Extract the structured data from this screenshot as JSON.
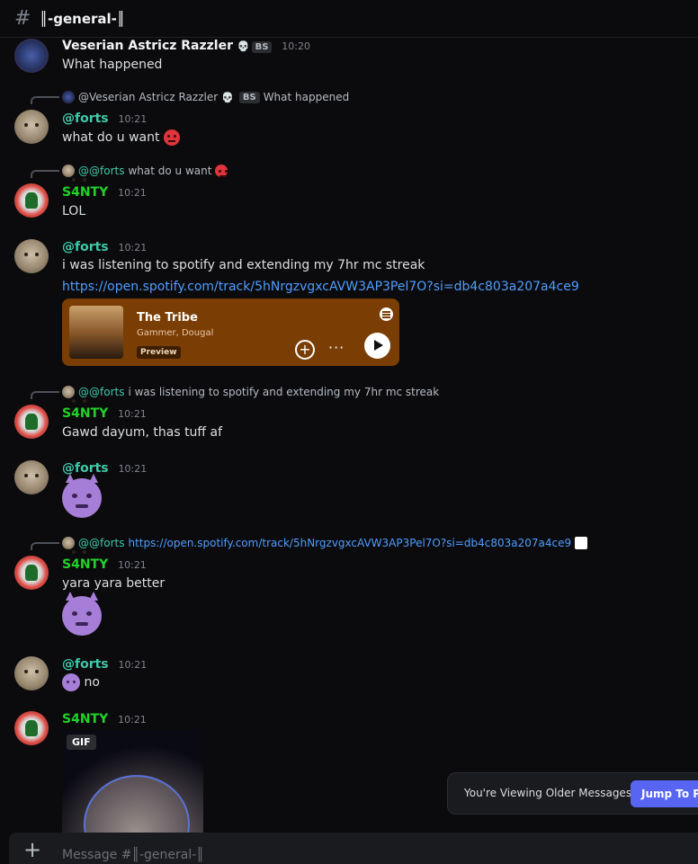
{
  "header": {
    "hash": "#",
    "channel_name": "║-general-║"
  },
  "messages": [
    {
      "author": "Veserian Astricz Razzler",
      "badge": "BS",
      "time": "10:20",
      "text": "What happened"
    },
    {
      "reply_to": "@Veserian Astricz Razzler",
      "reply_badge": "BS",
      "reply_text": "What happened",
      "author": "@forts",
      "time": "10:21",
      "text": "what do u want"
    },
    {
      "reply_to": "@@forts",
      "reply_text": "what do u want",
      "author": "S4NTY",
      "time": "10:21",
      "text": "LOL"
    },
    {
      "author": "@forts",
      "time": "10:21",
      "text": "i was listening to spotify and extending my 7hr mc streak",
      "link": "https://open.spotify.com/track/5hNrgzvgxcAVW3AP3Pel7O?si=db4c803a207a4ce9",
      "embed": {
        "track": "The Tribe",
        "artist": "Gammer, Dougal",
        "preview_label": "Preview",
        "add_label": "+",
        "more_label": "···"
      }
    },
    {
      "reply_to": "@@forts",
      "reply_text": "i was listening to spotify and extending my 7hr mc streak",
      "author": "S4NTY",
      "time": "10:21",
      "text": "Gawd dayum, thas tuff af"
    },
    {
      "author": "@forts",
      "time": "10:21"
    },
    {
      "reply_to": "@@forts",
      "reply_link": "https://open.spotify.com/track/5hNrgzvgxcAVW3AP3Pel7O?si=db4c803a207a4ce9",
      "author": "S4NTY",
      "time": "10:21",
      "text": "yara yara better"
    },
    {
      "author": "@forts",
      "time": "10:21",
      "text": "no"
    },
    {
      "author": "S4NTY",
      "time": "10:21",
      "gif_badge": "GIF"
    }
  ],
  "older_notice": {
    "text": "You're Viewing Older Messages",
    "jump_label": "Jump To Present"
  },
  "composer": {
    "plus": "+",
    "placeholder": "Message #║-general-║"
  },
  "colors": {
    "accent": "#5865f2",
    "santy_name": "#23d12a",
    "forts_name": "#3ec9a8",
    "spotify_embed": "#7a3d03"
  }
}
